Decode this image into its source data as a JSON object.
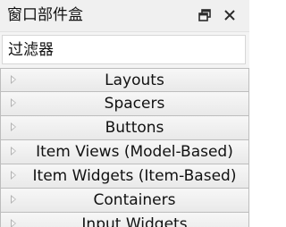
{
  "panel": {
    "title": "窗口部件盒",
    "float_icon": "restore-float-icon",
    "close_icon": "close-icon"
  },
  "filter": {
    "placeholder": "过滤器",
    "value": ""
  },
  "categories": [
    {
      "label": "Layouts",
      "expanded": false
    },
    {
      "label": "Spacers",
      "expanded": false
    },
    {
      "label": "Buttons",
      "expanded": false
    },
    {
      "label": "Item Views (Model-Based)",
      "expanded": false
    },
    {
      "label": "Item Widgets (Item-Based)",
      "expanded": false
    },
    {
      "label": "Containers",
      "expanded": false
    },
    {
      "label": "Input Widgets",
      "expanded": false
    }
  ],
  "colors": {
    "text": "#111111",
    "arrow": "#b3b3b3",
    "row_border": "#bdbdbd"
  }
}
